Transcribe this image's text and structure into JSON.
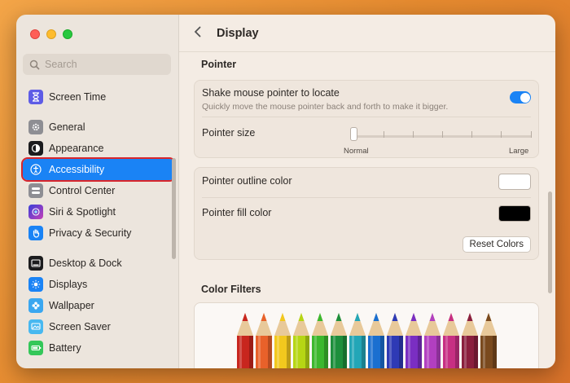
{
  "sidebar": {
    "search_placeholder": "Search",
    "items": [
      {
        "label": "Screen Time",
        "icon": "hourglass-icon",
        "color": "#5e5ce6"
      },
      {
        "label": "General",
        "icon": "gear-icon",
        "color": "#8e8e93"
      },
      {
        "label": "Appearance",
        "icon": "appearance-icon",
        "color": "#1c1c1e"
      },
      {
        "label": "Accessibility",
        "icon": "accessibility-icon",
        "color": "#1a83f5"
      },
      {
        "label": "Control Center",
        "icon": "control-center-icon",
        "color": "#8e8e93"
      },
      {
        "label": "Siri & Spotlight",
        "icon": "siri-icon",
        "color": "#7a4ad9"
      },
      {
        "label": "Privacy & Security",
        "icon": "hand-icon",
        "color": "#1a83f5"
      },
      {
        "label": "Desktop & Dock",
        "icon": "dock-icon",
        "color": "#1c1c1e"
      },
      {
        "label": "Displays",
        "icon": "sun-icon",
        "color": "#1a83f5"
      },
      {
        "label": "Wallpaper",
        "icon": "flower-icon",
        "color": "#3aa7f0"
      },
      {
        "label": "Screen Saver",
        "icon": "screen-saver-icon",
        "color": "#48b8f0"
      },
      {
        "label": "Battery",
        "icon": "battery-icon",
        "color": "#34c759"
      }
    ]
  },
  "header": {
    "title": "Display"
  },
  "pointer": {
    "heading": "Pointer",
    "shake_label": "Shake mouse pointer to locate",
    "shake_desc": "Quickly move the mouse pointer back and forth to make it bigger.",
    "shake_enabled": true,
    "size_label": "Pointer size",
    "size_min": "Normal",
    "size_max": "Large",
    "size_value": 0,
    "outline_label": "Pointer outline color",
    "outline_color": "#ffffff",
    "fill_label": "Pointer fill color",
    "fill_color": "#000000",
    "reset_label": "Reset Colors"
  },
  "filters": {
    "heading": "Color Filters",
    "pencil_colors": [
      "#c8261e",
      "#e8612a",
      "#f2c81e",
      "#b6d614",
      "#3cb82e",
      "#1d8f3c",
      "#23a6b7",
      "#1a6fd0",
      "#2e3ab5",
      "#7a2ec2",
      "#b23fc0",
      "#c72f83",
      "#8a1f3e",
      "#7a4a1e"
    ]
  }
}
